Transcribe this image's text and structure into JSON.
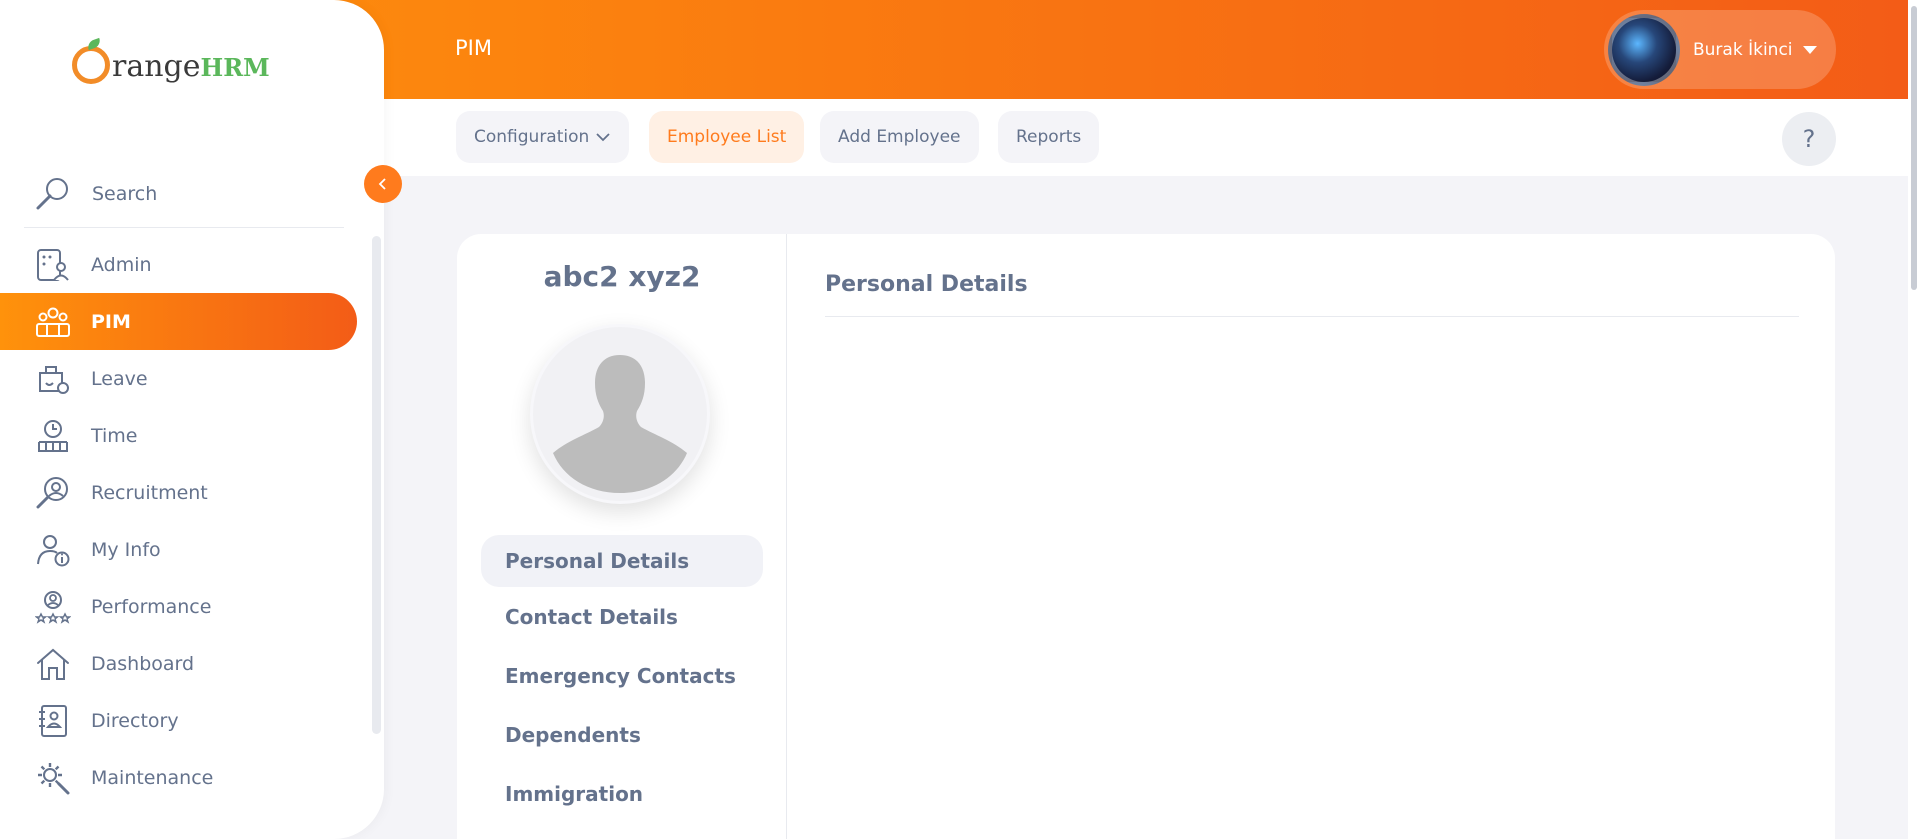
{
  "brand": {
    "name_part1": "range",
    "name_part2": "HRM"
  },
  "header": {
    "title": "PIM",
    "user_name": "Burak İkinci"
  },
  "sidebar": {
    "search_label": "Search",
    "items": [
      {
        "label": "Admin",
        "icon": "admin-icon"
      },
      {
        "label": "PIM",
        "icon": "pim-icon"
      },
      {
        "label": "Leave",
        "icon": "leave-icon"
      },
      {
        "label": "Time",
        "icon": "time-icon"
      },
      {
        "label": "Recruitment",
        "icon": "recruitment-icon"
      },
      {
        "label": "My Info",
        "icon": "my-info-icon"
      },
      {
        "label": "Performance",
        "icon": "performance-icon"
      },
      {
        "label": "Dashboard",
        "icon": "dashboard-icon"
      },
      {
        "label": "Directory",
        "icon": "directory-icon"
      },
      {
        "label": "Maintenance",
        "icon": "maintenance-icon"
      }
    ],
    "active_item": "PIM"
  },
  "topnav": {
    "configuration": "Configuration",
    "employee_list": "Employee List",
    "add_employee": "Add Employee",
    "reports": "Reports",
    "help": "?"
  },
  "employee": {
    "name": "abc2 xyz2",
    "tabs": [
      "Personal Details",
      "Contact Details",
      "Emergency Contacts",
      "Dependents",
      "Immigration"
    ],
    "active_tab": "Personal Details"
  },
  "main": {
    "section_title": "Personal Details"
  },
  "colors": {
    "accent": "#ff7b1d",
    "gradient_start": "#ff920b",
    "gradient_end": "#f35c17",
    "text": "#64728c"
  }
}
